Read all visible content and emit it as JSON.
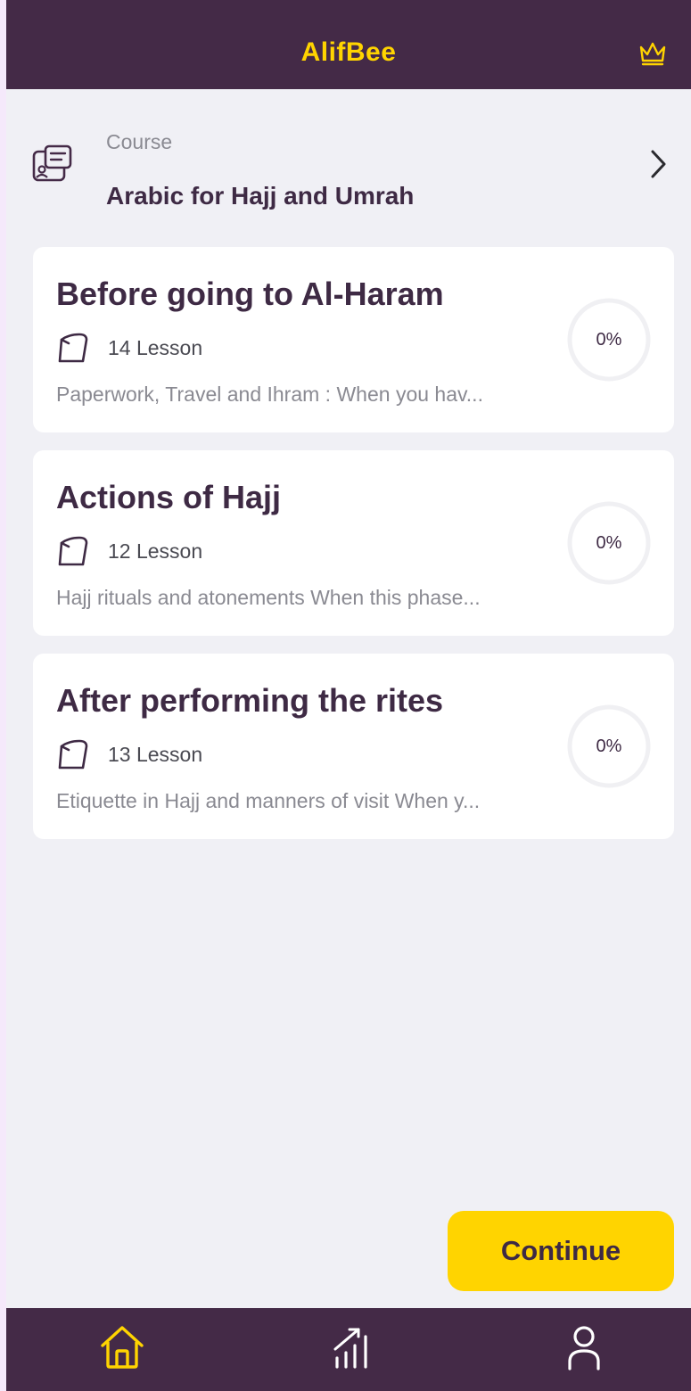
{
  "header": {
    "logo": "AlifBee",
    "premium_icon": "crown-icon"
  },
  "course": {
    "icon": "course-card-icon",
    "caption": "Course",
    "name": "Arabic for Hajj and Umrah",
    "chevron_icon": "chevron-right-icon"
  },
  "units": [
    {
      "title": "Before going to Al-Haram",
      "lessons": "14 Lesson",
      "description": "Paperwork, Travel and Ihram : When you hav...",
      "progress": "0%",
      "progress_value": 0
    },
    {
      "title": "Actions of Hajj",
      "lessons": "12 Lesson",
      "description": "Hajj rituals and atonements When this phase...",
      "progress": "0%",
      "progress_value": 0
    },
    {
      "title": "After performing the rites",
      "lessons": "13 Lesson",
      "description": "Etiquette in Hajj and manners of visit When y...",
      "progress": "0%",
      "progress_value": 0
    }
  ],
  "continue_label": "Continue",
  "bottom_nav": {
    "items": [
      {
        "icon": "home-icon",
        "active": true
      },
      {
        "icon": "stats-icon",
        "active": false
      },
      {
        "icon": "profile-icon",
        "active": false
      }
    ]
  },
  "colors": {
    "brand_dark": "#442a47",
    "accent": "#ffd400",
    "background": "#f0f0f5"
  }
}
